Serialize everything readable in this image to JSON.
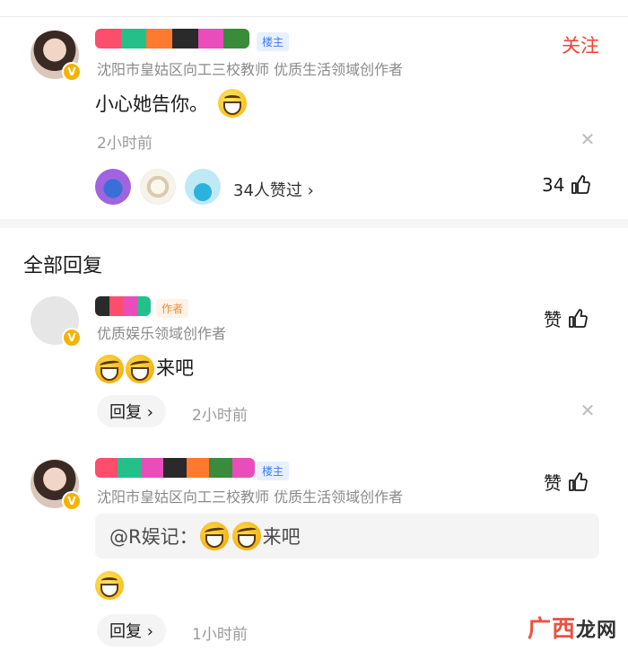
{
  "main_comment": {
    "owner_tag": "楼主",
    "subtitle": "沈阳市皇姑区向工三校教师 优质生活领域创作者",
    "follow_label": "关注",
    "text": "小心她告你。",
    "time": "2小时前",
    "likers_text": "34人赞过 ›",
    "like_count": "34"
  },
  "section": {
    "title": "全部回复"
  },
  "reply1": {
    "author_tag": "作者",
    "subtitle": "优质娱乐领域创作者",
    "text": "来吧",
    "like_label": "赞",
    "reply_label": "回复 ›",
    "time": "2小时前"
  },
  "reply2": {
    "owner_tag": "楼主",
    "subtitle": "沈阳市皇姑区向工三校教师 优质生活领域创作者",
    "quote_prefix": "@R娱记：",
    "quote_text": "来吧",
    "like_label": "赞",
    "reply_label": "回复 ›",
    "time": "1小时前"
  },
  "watermark": {
    "text_a": "广西",
    "text_b": "龙网"
  },
  "icons": {
    "verified": "verified-v-icon",
    "thumb": "thumbs-up-icon",
    "close": "close-icon",
    "emoji_grin": "grin-emoji-icon",
    "emoji_laugh": "laugh-emoji-icon"
  },
  "colors": {
    "accent_red": "#f0432f",
    "owner_tag_blue": "#3a7bff",
    "author_tag_orange": "#f08c3c",
    "verified_gold": "#f5b301"
  }
}
